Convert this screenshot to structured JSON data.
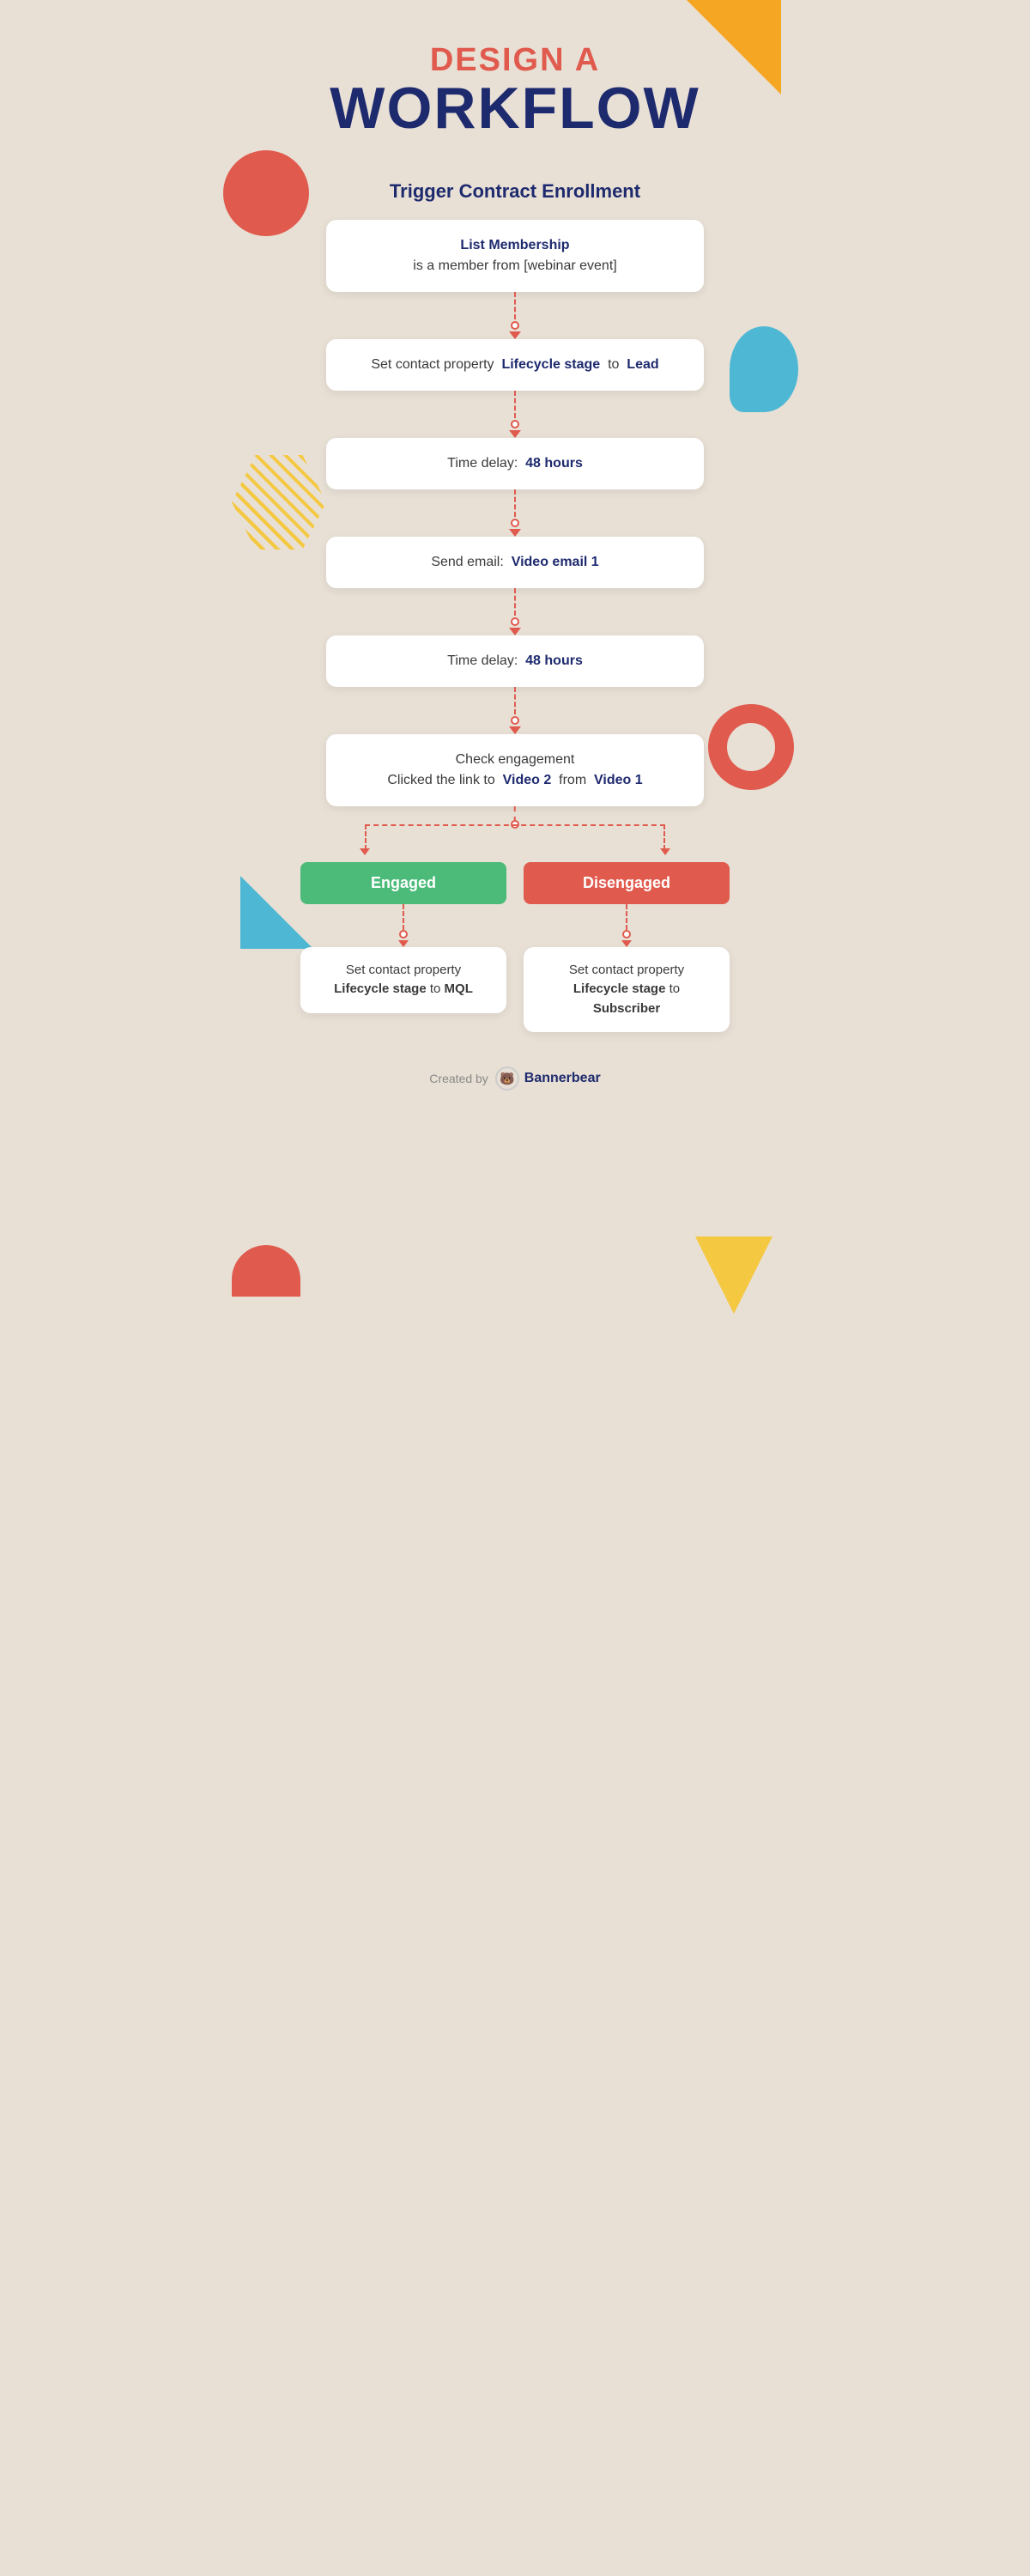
{
  "header": {
    "line1": "DESIGN A",
    "line2": "WORKFLOW"
  },
  "section_title": "Trigger Contract Enrollment",
  "cards": {
    "trigger": {
      "bold": "List Membership",
      "text": "is a member from [webinar event]"
    },
    "step1": {
      "prefix": "Set contact property",
      "bold": "Lifecycle stage",
      "middle": "to",
      "value": "Lead"
    },
    "step2": {
      "prefix": "Time delay:",
      "bold": "48 hours"
    },
    "step3": {
      "prefix": "Send email:",
      "bold": "Video email 1"
    },
    "step4": {
      "prefix": "Time delay:",
      "bold": "48 hours"
    },
    "step5": {
      "line1": "Check engagement",
      "prefix": "Clicked the link to",
      "bold1": "Video 2",
      "middle": "from",
      "bold2": "Video 1"
    }
  },
  "branches": {
    "engaged": {
      "label": "Engaged",
      "card_prefix": "Set contact property",
      "card_bold1": "Lifecycle stage",
      "card_middle": "to",
      "card_value": "MQL"
    },
    "disengaged": {
      "label": "Disengaged",
      "card_prefix": "Set contact property",
      "card_bold1": "Lifecycle stage",
      "card_middle": "to",
      "card_value": "Subscriber"
    }
  },
  "footer": {
    "created_by": "Created by",
    "brand": "Bannerbear"
  }
}
